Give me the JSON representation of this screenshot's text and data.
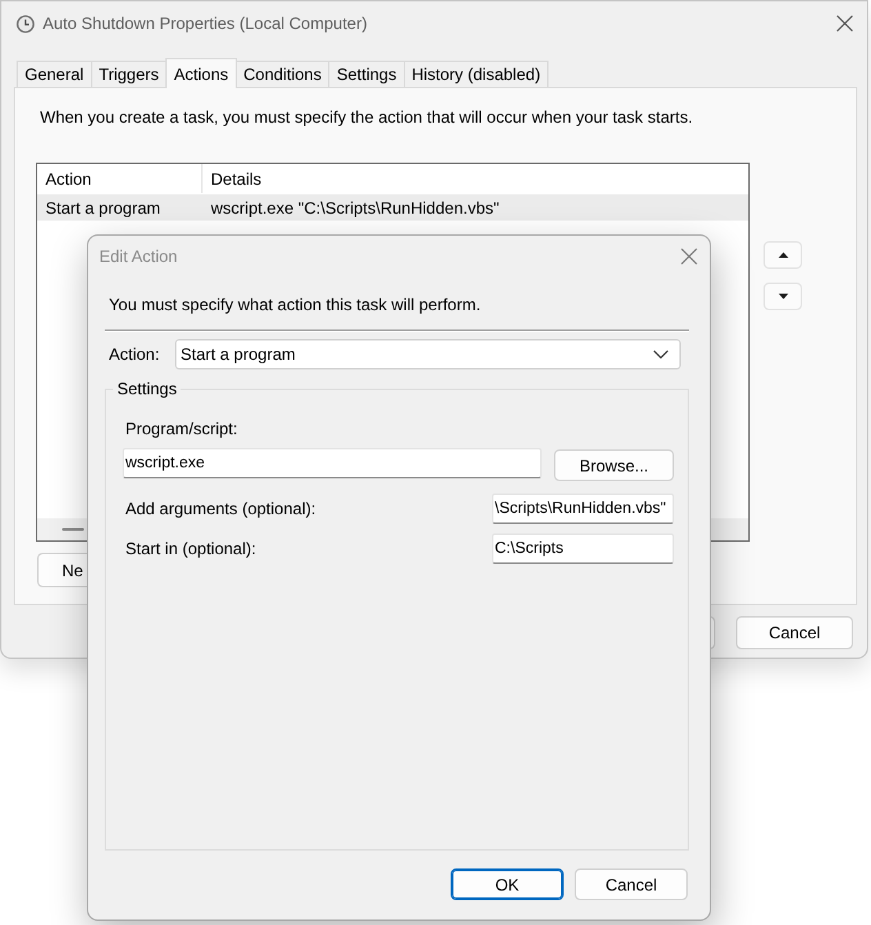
{
  "main_window": {
    "title": "Auto Shutdown Properties (Local Computer)",
    "tabs": [
      {
        "label": "General",
        "selected": false
      },
      {
        "label": "Triggers",
        "selected": false
      },
      {
        "label": "Actions",
        "selected": true
      },
      {
        "label": "Conditions",
        "selected": false
      },
      {
        "label": "Settings",
        "selected": false
      },
      {
        "label": "History (disabled)",
        "selected": false
      }
    ],
    "description": "When you create a task, you must specify the action that will occur when your task starts.",
    "actions_table": {
      "columns": [
        "Action",
        "Details"
      ],
      "rows": [
        {
          "action": "Start a program",
          "details": "wscript.exe \"C:\\Scripts\\RunHidden.vbs\"",
          "selected": true
        }
      ]
    },
    "new_button": "Ne",
    "buttons": [
      "Cancel"
    ]
  },
  "edit_action_dialog": {
    "title": "Edit Action",
    "instruction": "You must specify what action this task will perform.",
    "action_field": {
      "label": "Action:",
      "value": "Start a program"
    },
    "settings_group": "Settings",
    "fields": [
      {
        "kind": "stacked",
        "label": "Program/script:",
        "value": "wscript.exe",
        "button": "Browse..."
      },
      {
        "kind": "inline",
        "label": "Add arguments (optional):",
        "value": "\\Scripts\\RunHidden.vbs\""
      },
      {
        "kind": "inline",
        "label": "Start in (optional):",
        "value": "C:\\Scripts"
      }
    ],
    "buttons": [
      {
        "label": "OK",
        "default": true
      },
      {
        "label": "Cancel",
        "default": false
      }
    ]
  }
}
